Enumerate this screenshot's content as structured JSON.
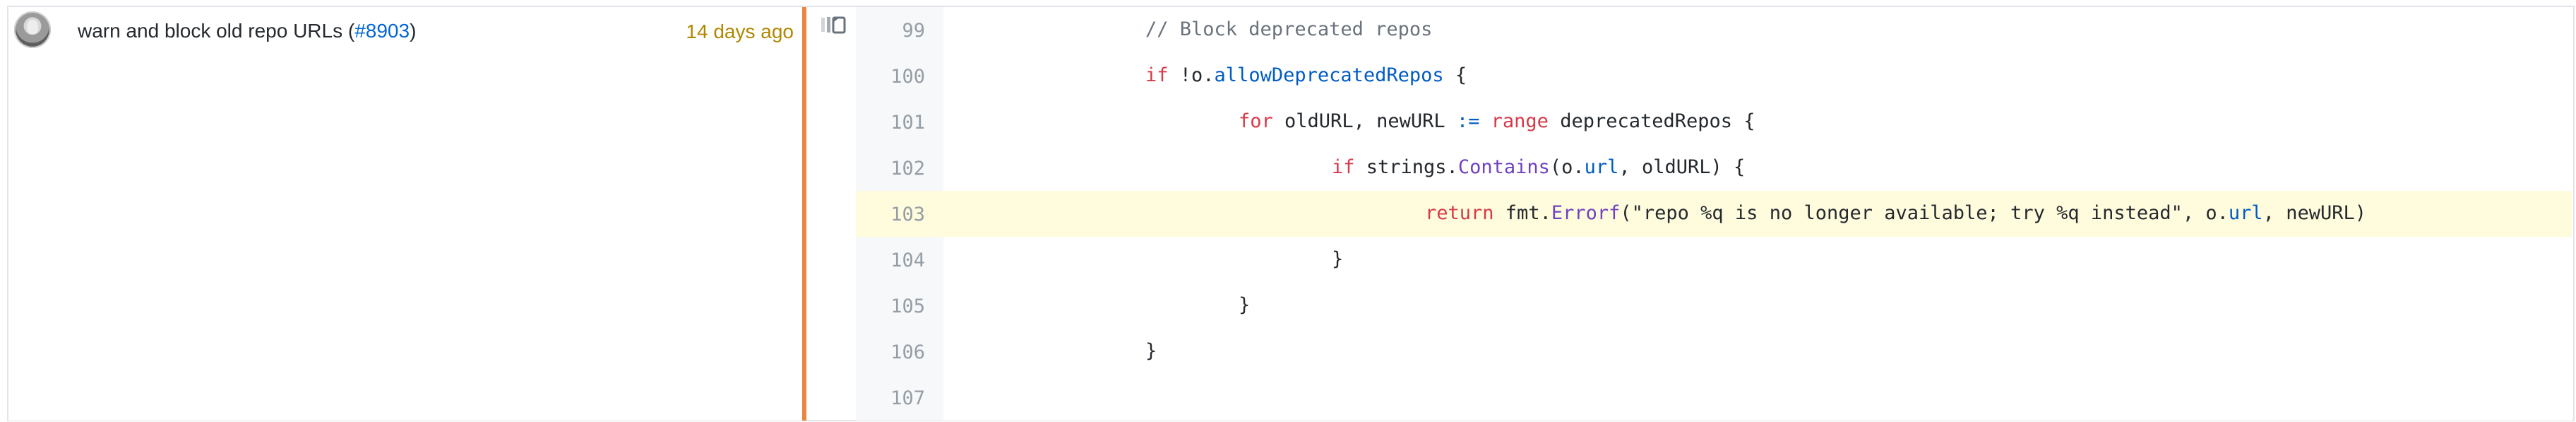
{
  "blame": {
    "commit_message": "warn and block old repo URLs (",
    "pr_link": "#8903",
    "commit_close": ")",
    "time": "14 days ago"
  },
  "code": {
    "lines": [
      {
        "number": "99",
        "indent": "\t",
        "tokens": [
          {
            "text": "// Block deprecated repos",
            "type": "comment"
          }
        ]
      },
      {
        "number": "100",
        "indent": "\t",
        "tokens": [
          {
            "text": "if",
            "type": "kw"
          },
          {
            "text": " !o.",
            "type": "plain"
          },
          {
            "text": "allowDeprecatedRepos",
            "type": "prop"
          },
          {
            "text": " {",
            "type": "plain"
          }
        ]
      },
      {
        "number": "101",
        "indent": "\t\t",
        "tokens": [
          {
            "text": "for",
            "type": "kw"
          },
          {
            "text": " oldURL, newURL ",
            "type": "plain"
          },
          {
            "text": ":=",
            "type": "prop"
          },
          {
            "text": " range",
            "type": "kw"
          },
          {
            "text": " deprecatedRepos {",
            "type": "plain"
          }
        ]
      },
      {
        "number": "102",
        "indent": "\t\t\t",
        "tokens": [
          {
            "text": "if",
            "type": "kw"
          },
          {
            "text": " strings.",
            "type": "plain"
          },
          {
            "text": "Contains",
            "type": "fn"
          },
          {
            "text": "(o.",
            "type": "plain"
          },
          {
            "text": "url",
            "type": "prop"
          },
          {
            "text": ", oldURL) {",
            "type": "plain"
          }
        ]
      },
      {
        "number": "103",
        "indent": "\t\t\t\t",
        "highlight": true,
        "tokens": [
          {
            "text": "return",
            "type": "kw"
          },
          {
            "text": " fmt.",
            "type": "plain"
          },
          {
            "text": "Errorf",
            "type": "fn"
          },
          {
            "text": "(\"repo %q is no longer available; try %q instead\", o.",
            "type": "plain"
          },
          {
            "text": "url",
            "type": "prop"
          },
          {
            "text": ", newURL)",
            "type": "plain"
          }
        ]
      },
      {
        "number": "104",
        "indent": "\t\t\t",
        "tokens": [
          {
            "text": "}",
            "type": "plain"
          }
        ]
      },
      {
        "number": "105",
        "indent": "\t\t",
        "tokens": [
          {
            "text": "}",
            "type": "plain"
          }
        ]
      },
      {
        "number": "106",
        "indent": "\t",
        "tokens": [
          {
            "text": "}",
            "type": "plain"
          }
        ]
      },
      {
        "number": "107",
        "indent": "",
        "tokens": []
      }
    ]
  },
  "colors": {
    "orange_bar": "#e8873d",
    "highlight": "#fffbdd",
    "link": "#0366d6",
    "time": "#b08800",
    "keyword": "#d73a49",
    "function": "#6f42c1",
    "property": "#005cc5",
    "comment": "#6a737d"
  },
  "icons": {
    "avatar": "avatar",
    "reblame": "reblame-icon"
  }
}
